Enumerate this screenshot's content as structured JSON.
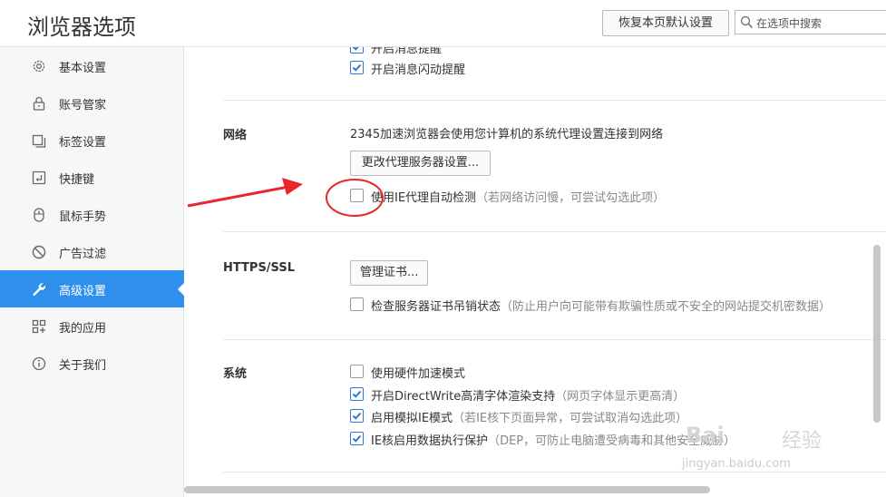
{
  "header": {
    "title": "浏览器选项",
    "reset_label": "恢复本页默认设置",
    "search_placeholder": "在选项中搜索"
  },
  "sidebar": {
    "items": [
      {
        "label": "基本设置",
        "icon": "gear-icon"
      },
      {
        "label": "账号管家",
        "icon": "lock-icon"
      },
      {
        "label": "标签设置",
        "icon": "tabs-icon"
      },
      {
        "label": "快捷键",
        "icon": "keyboard-key-icon"
      },
      {
        "label": "鼠标手势",
        "icon": "mouse-icon"
      },
      {
        "label": "广告过滤",
        "icon": "ban-icon"
      },
      {
        "label": "高级设置",
        "icon": "wrench-icon",
        "active": true
      },
      {
        "label": "我的应用",
        "icon": "apps-grid-icon"
      },
      {
        "label": "关于我们",
        "icon": "info-icon"
      }
    ]
  },
  "top_partial": {
    "cut_label": "开启消息提醒",
    "flash_label": "开启消息闪动提醒",
    "flash_checked": true
  },
  "network": {
    "title": "网络",
    "desc": "2345加速浏览器会使用您计算机的系统代理设置连接到网络",
    "proxy_button": "更改代理服务器设置...",
    "ie_proxy_label": "使用IE代理自动检测",
    "ie_proxy_hint": "（若网络访问慢，可尝试勾选此项）",
    "ie_proxy_checked": false
  },
  "https": {
    "title": "HTTPS/SSL",
    "cert_button": "管理证书...",
    "revoke_label": "检查服务器证书吊销状态",
    "revoke_hint": "（防止用户向可能带有欺骗性质或不安全的网站提交机密数据）",
    "revoke_checked": false
  },
  "system": {
    "title": "系统",
    "items": [
      {
        "label": "使用硬件加速模式",
        "hint": "",
        "checked": false
      },
      {
        "label": "开启DirectWrite高清字体渲染支持",
        "hint": "（网页字体显示更高清）",
        "checked": true
      },
      {
        "label": "启用模拟IE模式",
        "hint": "（若IE核下页面异常，可尝试取消勾选此项）",
        "checked": true
      },
      {
        "label": "IE核启用数据执行保护",
        "hint": "（DEP，可防止电脑遭受病毒和其他安全威胁）",
        "checked": true
      }
    ]
  },
  "watermark": {
    "logo": "Bai",
    "word": "经验",
    "url": "jingyan.baidu.com"
  },
  "colors": {
    "accent": "#2f8fec",
    "annotation": "#e8262c",
    "checkbox": "#2c78d5"
  }
}
